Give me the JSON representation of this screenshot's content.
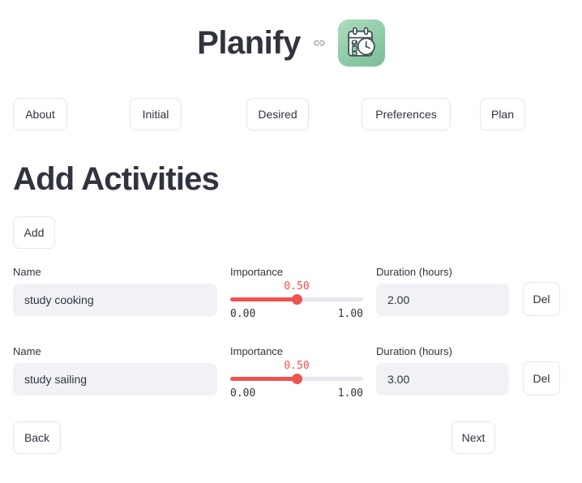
{
  "header": {
    "app_title": "Planify",
    "link_icon": "link-icon",
    "app_icon": "calendar-clock-icon",
    "icon_colors": {
      "bg_start": "#aedcbe",
      "bg_end": "#7cbd98"
    }
  },
  "nav": {
    "items": [
      {
        "id": "about",
        "label": "About"
      },
      {
        "id": "initial",
        "label": "Initial"
      },
      {
        "id": "desired",
        "label": "Desired"
      },
      {
        "id": "preferences",
        "label": "Preferences"
      },
      {
        "id": "plan",
        "label": "Plan"
      }
    ]
  },
  "main": {
    "page_title": "Add Activities",
    "add_label": "Add",
    "labels": {
      "name": "Name",
      "importance": "Importance",
      "duration": "Duration (hours)",
      "delete": "Del",
      "minus": "−",
      "plus": "+"
    },
    "slider": {
      "min_label": "0.00",
      "max_label": "1.00",
      "min": 0,
      "max": 1,
      "accent": "#ef5350",
      "track": "#e6e9ef"
    },
    "activities": [
      {
        "name": "study cooking",
        "name_placeholder": "",
        "importance_value": "0.50",
        "importance_pct": 50,
        "duration": "2.00",
        "plus_active": false
      },
      {
        "name": "study sailing",
        "name_placeholder": "",
        "importance_value": "0.50",
        "importance_pct": 50,
        "duration": "3.00",
        "plus_active": true
      }
    ]
  },
  "footer": {
    "back_label": "Back",
    "next_label": "Next"
  }
}
